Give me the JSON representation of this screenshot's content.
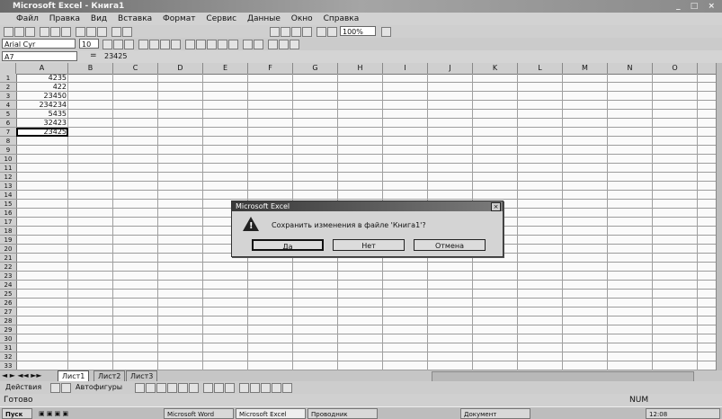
{
  "window": {
    "title": "Microsoft Excel - Книга1"
  },
  "window_controls": {
    "min": "_",
    "max": "□",
    "close": "×"
  },
  "menu": [
    "Файл",
    "Правка",
    "Вид",
    "Вставка",
    "Формат",
    "Сервис",
    "Данные",
    "Окно",
    "Справка"
  ],
  "format_toolbar": {
    "font": "Arial Cyr",
    "size": "10",
    "zoom": "100%"
  },
  "formula_bar": {
    "name_box": "A7",
    "value": "23425"
  },
  "columns": [
    "A",
    "B",
    "C",
    "D",
    "E",
    "F",
    "G",
    "H",
    "I",
    "J",
    "K",
    "L",
    "M",
    "N",
    "O"
  ],
  "rows": [
    "1",
    "2",
    "3",
    "4",
    "5",
    "6",
    "7",
    "8",
    "9",
    "10",
    "11",
    "12",
    "13",
    "14",
    "15",
    "16",
    "17",
    "18",
    "19",
    "20",
    "21",
    "22",
    "23",
    "24",
    "25",
    "26",
    "27",
    "28",
    "29",
    "30",
    "31",
    "32",
    "33"
  ],
  "cells_colA": [
    "4235",
    "422",
    "23450",
    "234234",
    "5435",
    "32423",
    "23425"
  ],
  "sheet_tabs": [
    "Лист1",
    "Лист2",
    "Лист3"
  ],
  "drawbar": {
    "draw": "Действия",
    "autoshapes": "Автофигуры"
  },
  "status": {
    "left": "Готово",
    "right": "NUM"
  },
  "taskbar": {
    "start": "Пуск",
    "items": [
      "Microsoft Word",
      "Microsoft Excel",
      "Проводник",
      "Документ"
    ],
    "clock": "12:08"
  },
  "dialog": {
    "title": "Microsoft Excel",
    "message": "Сохранить изменения в файле 'Книга1'?",
    "buttons": [
      "Да",
      "Нет",
      "Отмена"
    ]
  }
}
